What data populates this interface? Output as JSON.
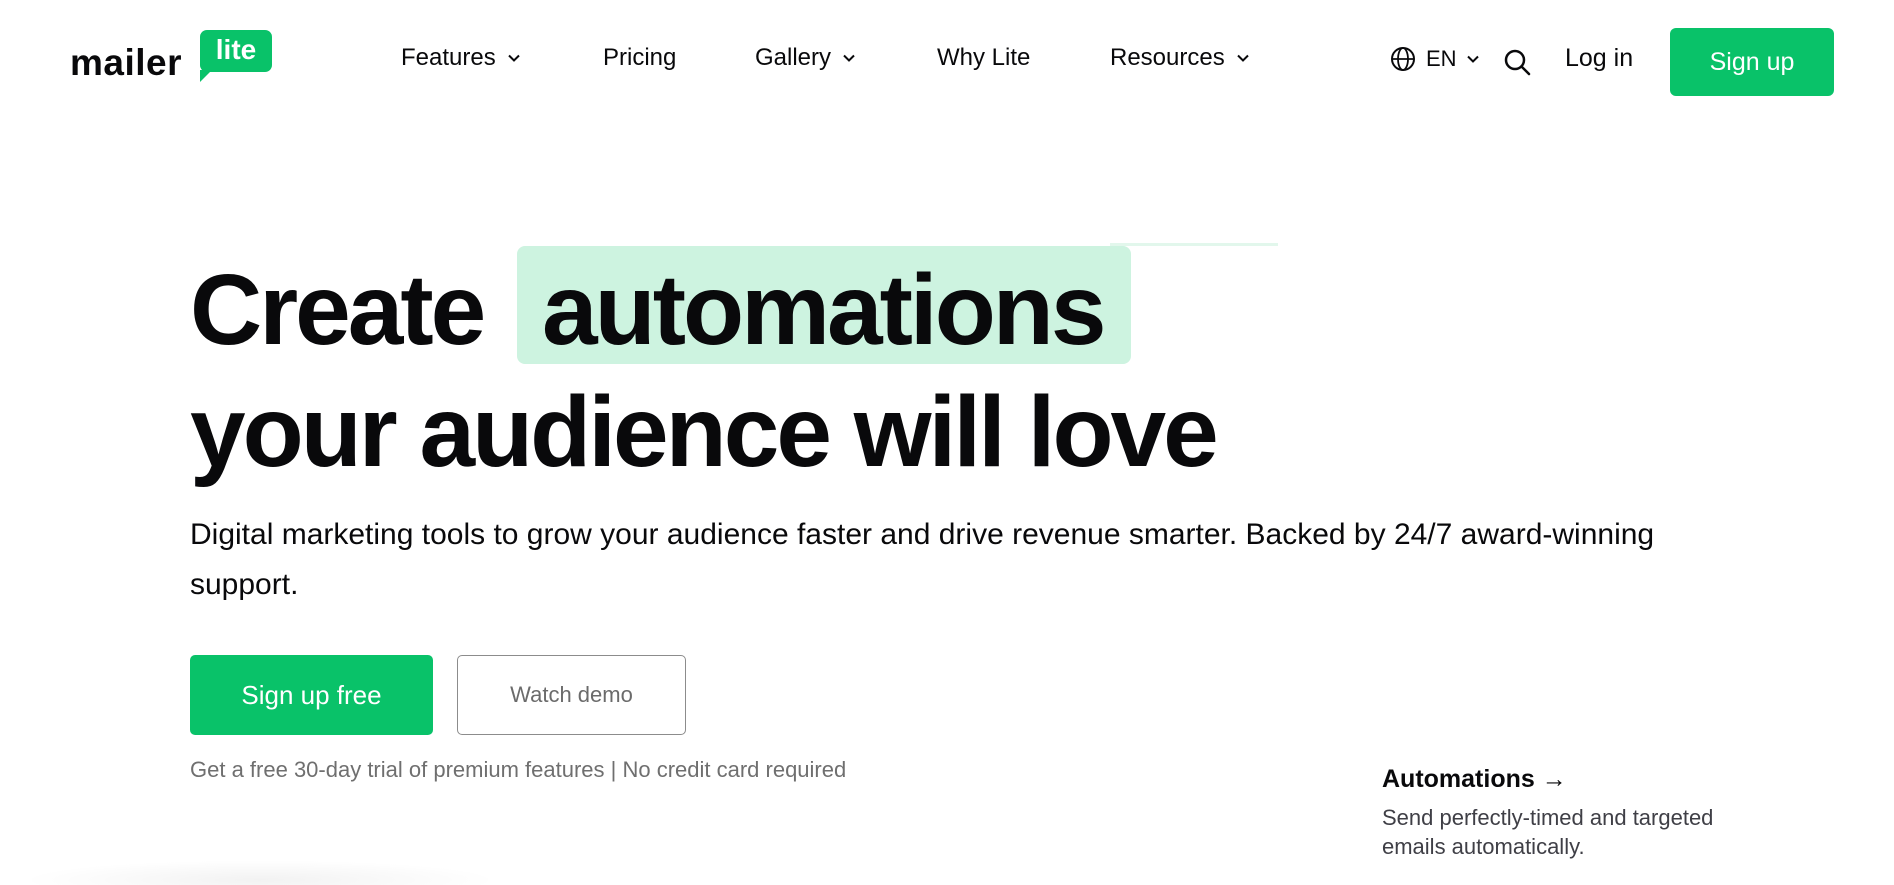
{
  "brand": {
    "name_word": "mailer",
    "badge_word": "lite",
    "accent_color": "#09c269",
    "highlight_color": "#cdf3e0"
  },
  "nav": {
    "items": [
      {
        "label": "Features",
        "dropdown": true
      },
      {
        "label": "Pricing",
        "dropdown": false
      },
      {
        "label": "Gallery",
        "dropdown": true
      },
      {
        "label": "Why Lite",
        "dropdown": false
      },
      {
        "label": "Resources",
        "dropdown": true
      }
    ],
    "language": {
      "label": "EN",
      "icon": "globe-icon"
    },
    "search_icon": "search-icon",
    "login_label": "Log in",
    "signup_label": "Sign up"
  },
  "hero": {
    "line1_prefix": "Create",
    "line1_highlight": "automations",
    "line2": "your audience will love",
    "subtitle": "Digital marketing tools to grow your audience faster and drive revenue smarter. Backed by 24/7 award-winning support.",
    "primary_cta": "Sign up free",
    "secondary_cta": "Watch demo",
    "trial_note": "Get a free 30-day trial of premium features | No credit card required"
  },
  "feature_card": {
    "title": "Automations",
    "arrow": "→",
    "description": "Send perfectly-timed and targeted emails automatically."
  }
}
